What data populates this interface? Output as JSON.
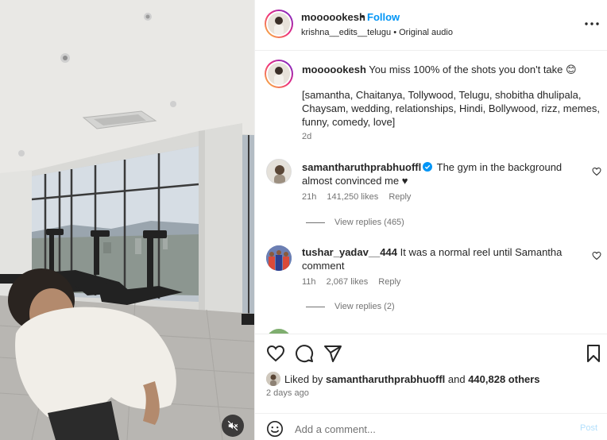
{
  "header": {
    "username": "moooookesh",
    "separator": "•",
    "follow_label": "Follow",
    "audio_line": "krishna__edits__telugu • Original audio",
    "more_icon": "more-horizontal-icon"
  },
  "caption": {
    "username": "moooookesh",
    "text": "You miss 100% of the shots you don't take 😊",
    "tags": "[samantha, Chaitanya, Tollywood, Telugu, shobitha dhulipala, Chaysam, wedding, relationships, Hindi, Bollywood, rizz, memes, funny, comedy, love]",
    "time": "2d"
  },
  "comments": [
    {
      "username": "samantharuthprabhuoffl",
      "verified": true,
      "text": "The gym in the background almost convinced me ♥",
      "time": "21h",
      "likes": "141,250 likes",
      "reply_label": "Reply",
      "view_replies": "View replies (465)"
    },
    {
      "username": "tushar_yadav__444",
      "verified": false,
      "text": "It was a normal reel until Samantha comment",
      "time": "11h",
      "likes": "2,067 likes",
      "reply_label": "Reply",
      "view_replies": "View replies (2)"
    }
  ],
  "actions": {
    "like_icon": "heart-icon",
    "comment_icon": "comment-icon",
    "share_icon": "share-icon",
    "save_icon": "bookmark-icon"
  },
  "likes": {
    "prefix": "Liked by ",
    "user": "samantharuthprabhuoffl",
    "middle": " and ",
    "others": "440,828 others"
  },
  "date": "2 days ago",
  "add_comment": {
    "placeholder": "Add a comment...",
    "post_label": "Post",
    "emoji_icon": "emoji-icon"
  },
  "media": {
    "mute_icon": "speaker-muted-icon"
  },
  "colors": {
    "link_blue": "#0095f6",
    "muted_text": "#737373",
    "post_disabled": "#b2dffc",
    "verified_blue": "#0095f6"
  }
}
